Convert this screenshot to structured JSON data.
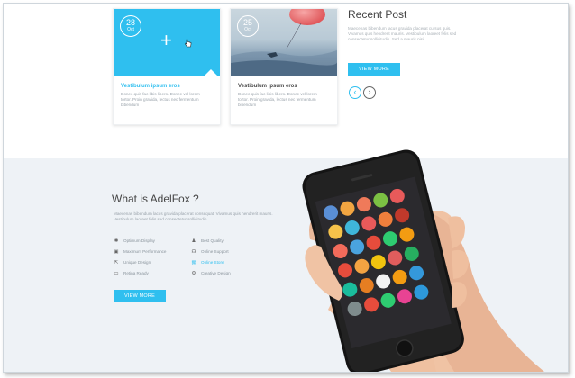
{
  "cards": [
    {
      "date_day": "28",
      "date_month": "Oct",
      "title": "Vestibulum ipsum eros",
      "description": "Donec quis fac libis libero. Donec vel lorem tortor. Proin gravida, lectus nec fermentum bibendum"
    },
    {
      "date_day": "25",
      "date_month": "Oct",
      "title": "Vestibulum ipsum eros",
      "description": "Donec quis fac libis libero. Donec vel lorem tortor. Proin gravida, lectus nec fermentum bibendum"
    }
  ],
  "recent_post": {
    "title": "Recent Post",
    "description": "Maecenas bibendum lacus gravida placerat cursus quis. Vivamus quis hendrerit mauris. Vestibulum laoreet felis sed consectetur sollicitudin. Sed a mauris nisi.",
    "button_label": "VIEW MORE",
    "prev_symbol": "‹",
    "next_symbol": "›"
  },
  "about": {
    "title": "What is AdelFox ?",
    "description": "Maecenas bibendum lacus gravida placerat consequat. Vivamus quis hendrerit mauris. Vestibulum laoreet felis sed consectetur sollicitudin.",
    "features_left": [
      "Optimum Display",
      "Maximum Performance",
      "Unique Design",
      "Retina Ready"
    ],
    "features_right": [
      "Best Quality",
      "Online Support",
      "Online Store",
      "Creative Design"
    ],
    "button_label": "VIEW MORE"
  },
  "colors": {
    "accent": "#2fbfef",
    "section_bg": "#eef2f6"
  }
}
